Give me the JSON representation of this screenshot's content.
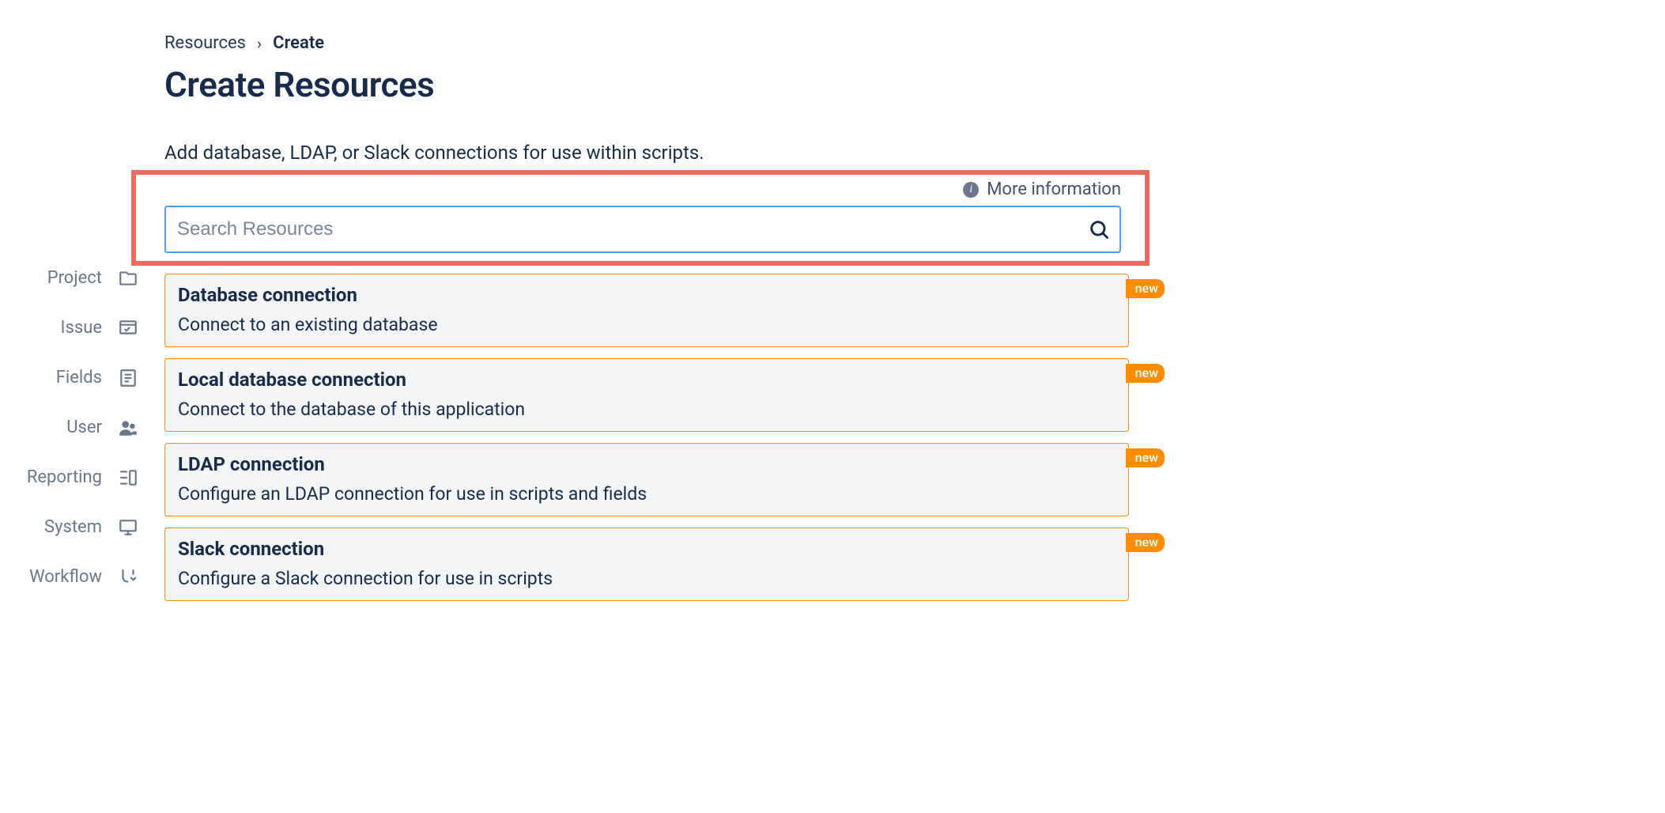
{
  "sidebar": {
    "items": [
      {
        "label": "Project",
        "icon": "folder-icon"
      },
      {
        "label": "Issue",
        "icon": "issue-icon"
      },
      {
        "label": "Fields",
        "icon": "fields-icon"
      },
      {
        "label": "User",
        "icon": "users-icon"
      },
      {
        "label": "Reporting",
        "icon": "reporting-icon"
      },
      {
        "label": "System",
        "icon": "system-icon"
      },
      {
        "label": "Workflow",
        "icon": "workflow-icon"
      }
    ]
  },
  "breadcrumb": {
    "root": "Resources",
    "current": "Create"
  },
  "page": {
    "title": "Create Resources",
    "description": "Add database, LDAP, or Slack connections for use within scripts."
  },
  "more_info": {
    "label": "More information"
  },
  "search": {
    "placeholder": "Search Resources",
    "value": ""
  },
  "badge": {
    "new": "new"
  },
  "resources": [
    {
      "title": "Database connection",
      "desc": "Connect to an existing database",
      "badge": "new"
    },
    {
      "title": "Local database connection",
      "desc": "Connect to the database of this application",
      "badge": "new"
    },
    {
      "title": "LDAP connection",
      "desc": "Configure an LDAP connection for use in scripts and fields",
      "badge": "new"
    },
    {
      "title": "Slack connection",
      "desc": "Configure a Slack connection for use in scripts",
      "badge": "new"
    }
  ]
}
